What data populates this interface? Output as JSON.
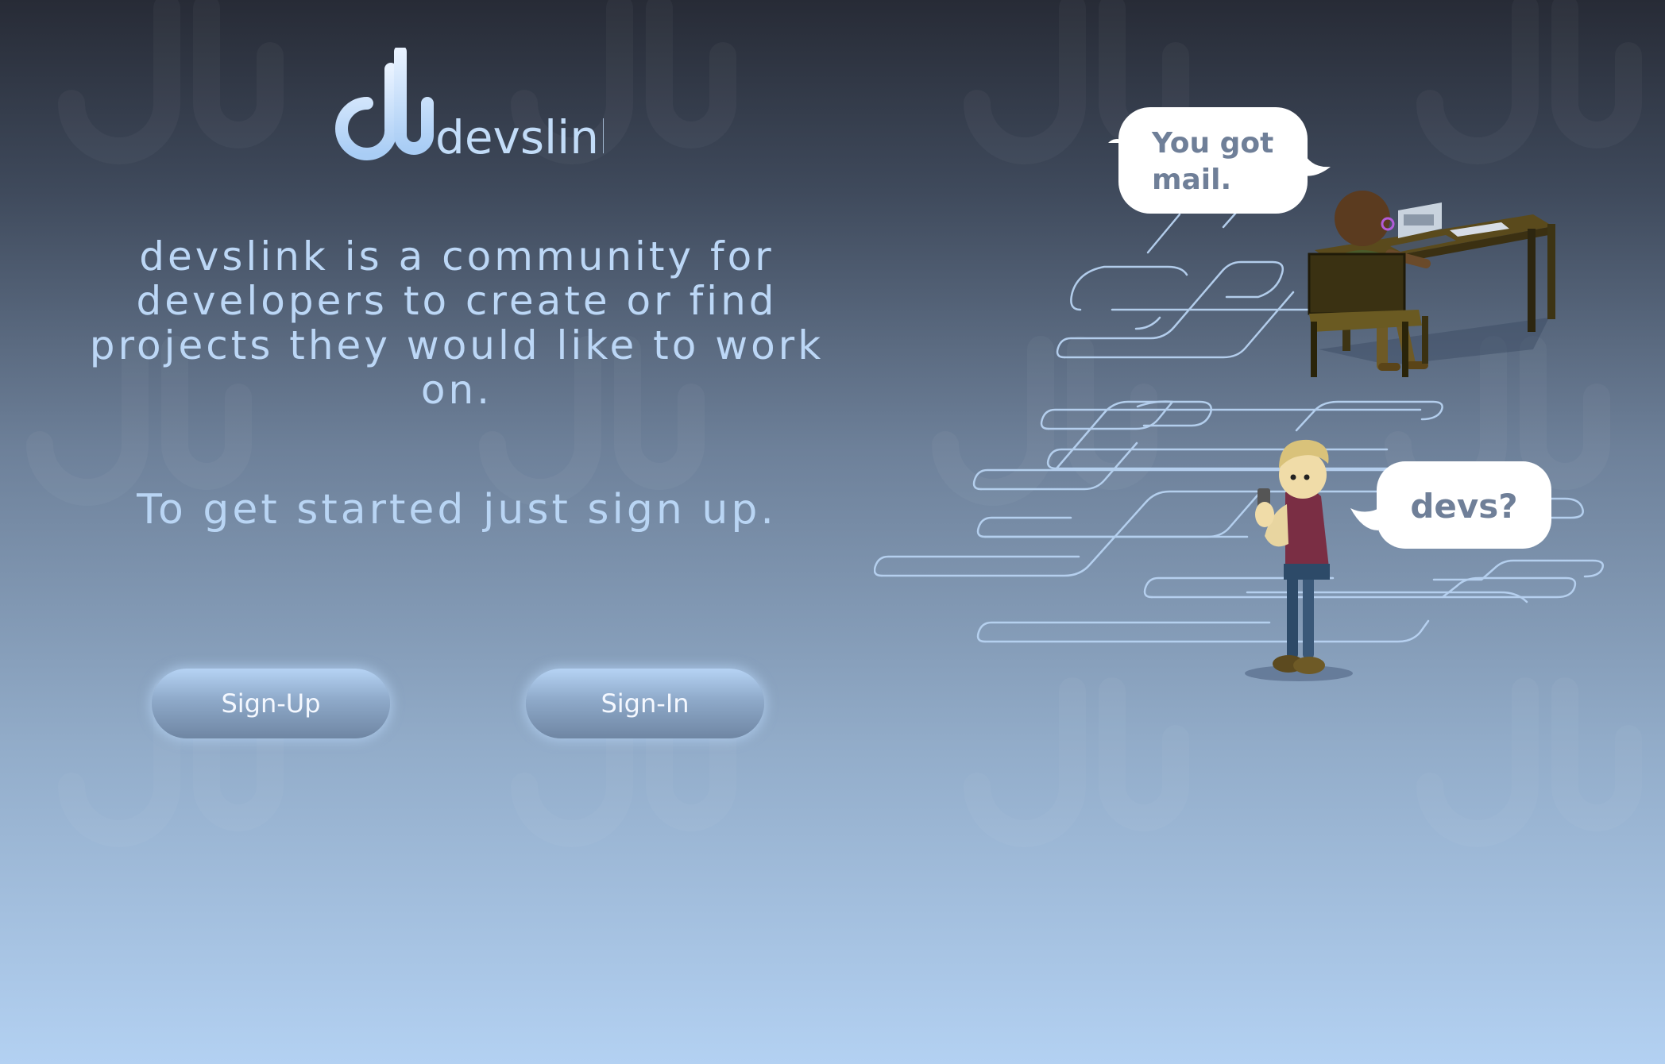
{
  "brand": {
    "name": "devslink",
    "logo_mark": "dl",
    "logo_wordmark": "devslink"
  },
  "hero": {
    "tagline": "devslink is a community for developers to create or find projects they would like to work on.",
    "cta_text": "To get started just sign up."
  },
  "actions": {
    "signup_label": "Sign-Up",
    "signin_label": "Sign-In"
  },
  "illustration": {
    "bubble_top": "You got mail.",
    "bubble_bottom": "devs?"
  },
  "colors": {
    "text_light_blue": "#bcd7f6",
    "bubble_text": "#6f7f98",
    "background_top": "#272b36",
    "background_bottom": "#b3d1f2"
  }
}
